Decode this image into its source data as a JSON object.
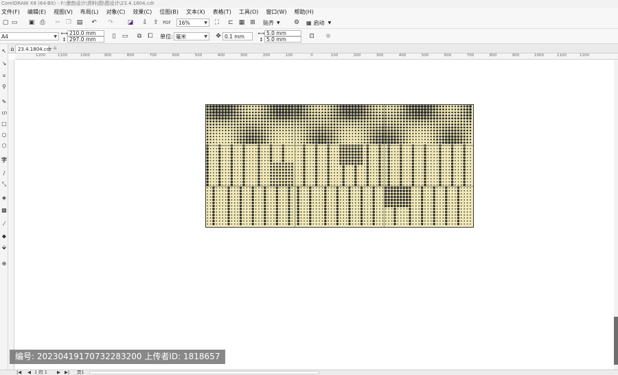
{
  "window": {
    "title": "CorelDRAW X8 (64-Bit) - F:\\墨韵设计\\资料\\图\\图设计\\23.4.1804.cdr"
  },
  "menu": [
    "文件(F)",
    "编辑(E)",
    "视图(V)",
    "布局(L)",
    "对象(C)",
    "效果(C)",
    "位图(B)",
    "文本(X)",
    "表格(T)",
    "工具(O)",
    "窗口(W)",
    "帮助(H)"
  ],
  "toolbar": {
    "zoom": "16%",
    "snap_label": "贴齐",
    "launch_label": "启动"
  },
  "properties": {
    "paper": "A4",
    "width": "210.0 mm",
    "height": "297.0 mm",
    "units_label": "单位:",
    "units_value": "毫米",
    "nudge": "0.1 mm",
    "dup_x": "5.0 mm",
    "dup_y": "5.0 mm"
  },
  "document": {
    "tab_label": "23.4.1804.cdr"
  },
  "ruler": {
    "labels": [
      "1200",
      "1100",
      "1000",
      "900",
      "800",
      "700",
      "600",
      "500",
      "400",
      "300",
      "200",
      "100",
      "0",
      "100",
      "200",
      "300",
      "400",
      "500",
      "600",
      "700",
      "800",
      "900",
      "1000",
      "1100",
      "1200"
    ]
  },
  "status": {
    "page_nav": "1 的 1",
    "page_tab": "页1"
  },
  "watermark": {
    "text": "编号: 20230419170732283200  上传者ID: 1818657"
  },
  "colors": {
    "panel_fill": "#f1e9b9",
    "dot": "#2b2b2b",
    "scroll_thumb": "#6f6f6f"
  }
}
